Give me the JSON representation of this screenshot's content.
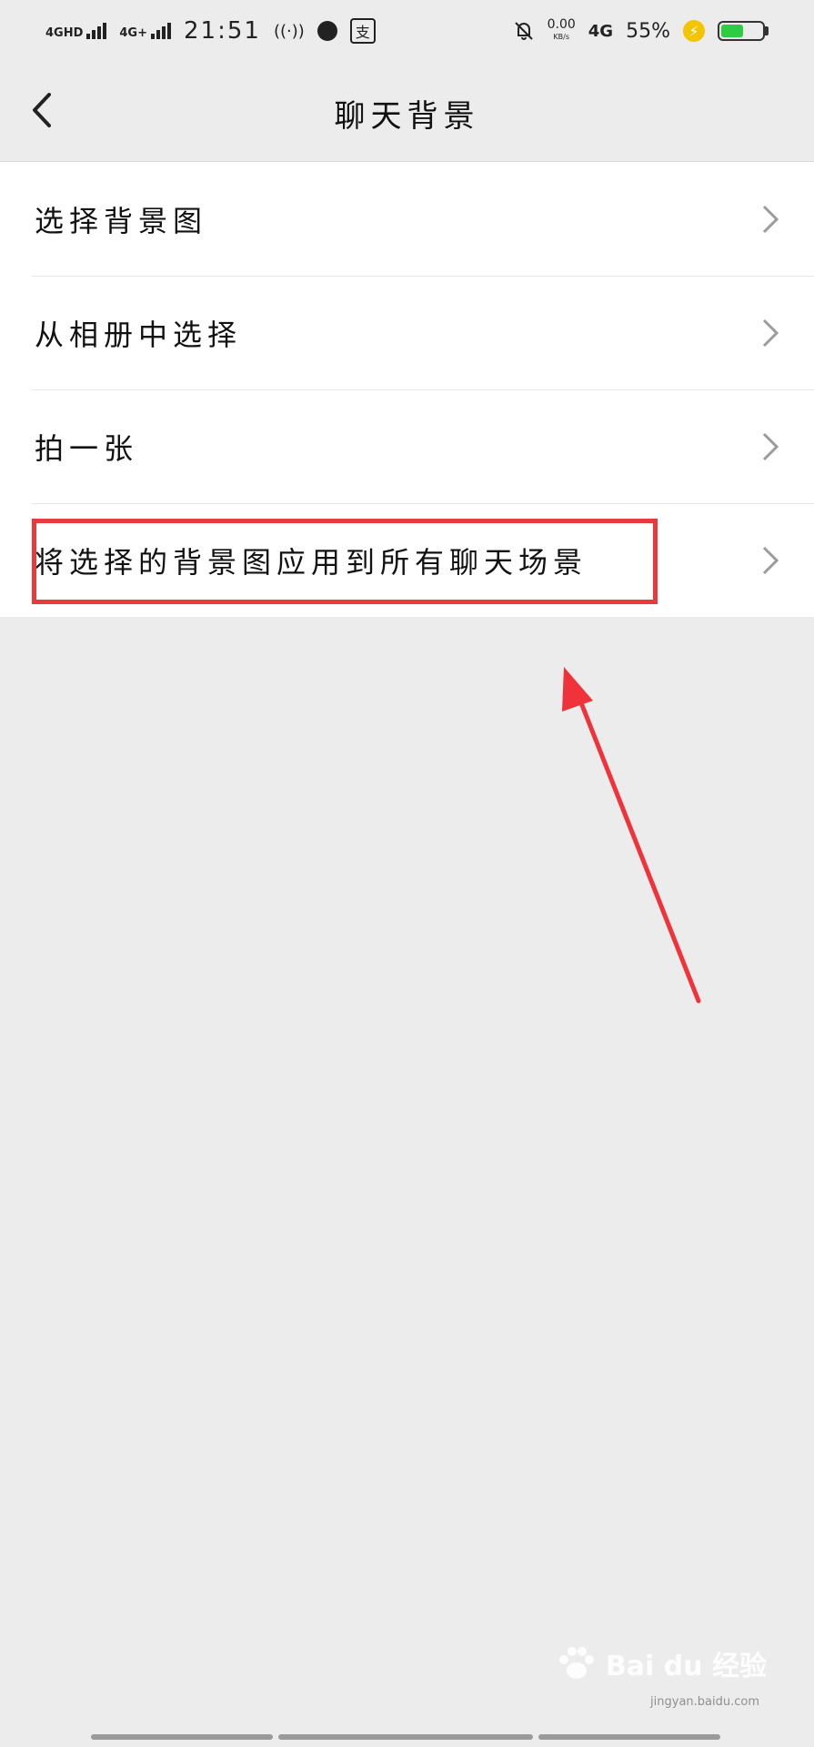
{
  "status_bar": {
    "sim1_label": "4GHD",
    "sim2_label": "4G+",
    "time": "21:51",
    "hotspot_icon": "((·))",
    "alipay_icon": "支",
    "net_speed_value": "0.00",
    "net_speed_unit": "KB/s",
    "network_type": "4G",
    "battery_percent": "55%",
    "battery_level": 0.55,
    "battery_color": "#2ecc40"
  },
  "navbar": {
    "title": "聊天背景",
    "back_icon": "chevron-left-icon"
  },
  "menu": {
    "items": [
      {
        "label": "选择背景图"
      },
      {
        "label": "从相册中选择"
      },
      {
        "label": "拍一张"
      },
      {
        "label": "将选择的背景图应用到所有聊天场景"
      }
    ]
  },
  "annotation": {
    "highlight_color": "#e83a3a",
    "arrow_color": "#f0333a"
  },
  "watermark": {
    "logo_text": "Bai du 经验",
    "sub_text": "jingyan.baidu.com"
  },
  "colors": {
    "background": "#ececec",
    "list_background": "#ffffff"
  }
}
